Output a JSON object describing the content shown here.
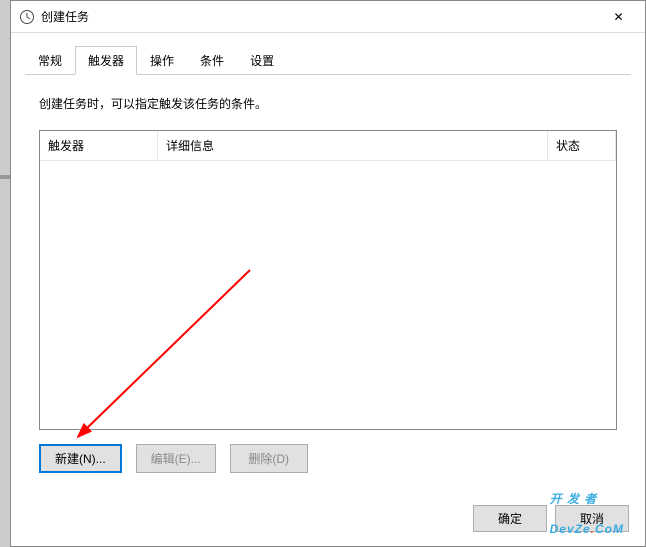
{
  "window": {
    "title": "创建任务",
    "close_symbol": "✕"
  },
  "tabs": [
    {
      "label": "常规"
    },
    {
      "label": "触发器",
      "active": true
    },
    {
      "label": "操作"
    },
    {
      "label": "条件"
    },
    {
      "label": "设置"
    }
  ],
  "panel": {
    "help_text": "创建任务时，可以指定触发该任务的条件。",
    "columns": {
      "trigger": "触发器",
      "detail": "详细信息",
      "status": "状态"
    },
    "buttons": {
      "new": "新建(N)...",
      "edit": "编辑(E)...",
      "delete": "删除(D)"
    }
  },
  "footer": {
    "ok": "确定",
    "cancel": "取消"
  },
  "watermark": {
    "line1": "开 发 者",
    "line2a": "DevZe",
    "line2b": "CoM"
  }
}
